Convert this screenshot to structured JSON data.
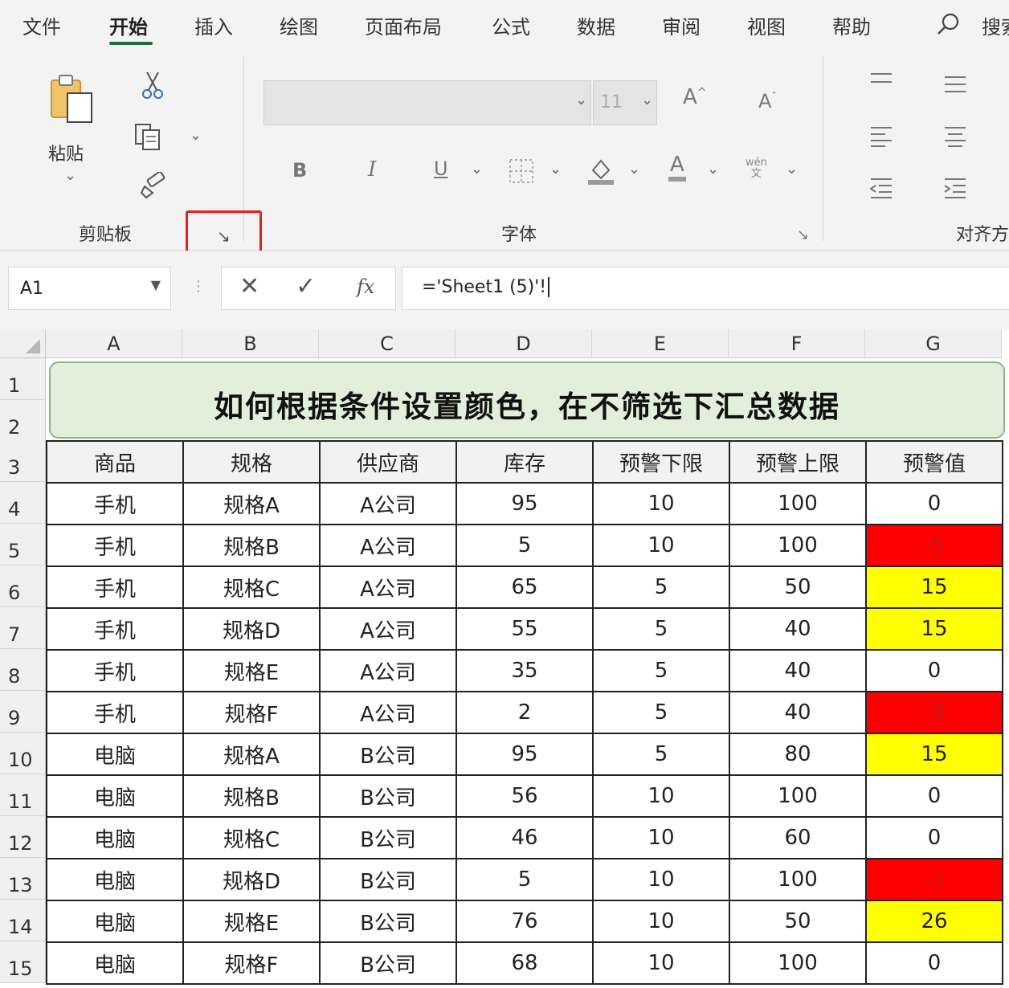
{
  "ribbon_tabs": [
    "文件",
    "开始",
    "插入",
    "绘图",
    "页面布局",
    "公式",
    "数据",
    "审阅",
    "视图",
    "帮助"
  ],
  "search_label": "搜索",
  "clipboard": {
    "paste_label": "粘贴",
    "group_label": "剪贴板"
  },
  "font": {
    "font_name": "",
    "font_size": "11",
    "bold": "B",
    "italic": "I",
    "underline": "U",
    "increase_size": "A",
    "decrease_size": "A",
    "font_color": "A",
    "phonetic": "wén",
    "group_label": "字体"
  },
  "alignment": {
    "group_label": "对齐方式"
  },
  "formula_bar": {
    "name_box": "A1",
    "fx": "fx",
    "formula": "='Sheet1 (5)'!"
  },
  "sheet": {
    "columns": [
      "A",
      "B",
      "C",
      "D",
      "E",
      "F",
      "G"
    ],
    "rows": [
      "1",
      "2",
      "3",
      "4",
      "5",
      "6",
      "7",
      "8",
      "9",
      "10",
      "11",
      "12",
      "13",
      "14",
      "15"
    ],
    "title": "如何根据条件设置颜色，在不筛选下汇总数据",
    "headers": [
      "商品",
      "规格",
      "供应商",
      "库存",
      "预警下限",
      "预警上限",
      "预警值"
    ],
    "data_rows": [
      [
        "手机",
        "规格A",
        "A公司",
        "95",
        "10",
        "100",
        "0"
      ],
      [
        "手机",
        "规格B",
        "A公司",
        "5",
        "10",
        "100",
        "-5"
      ],
      [
        "手机",
        "规格C",
        "A公司",
        "65",
        "5",
        "50",
        "15"
      ],
      [
        "手机",
        "规格D",
        "A公司",
        "55",
        "5",
        "40",
        "15"
      ],
      [
        "手机",
        "规格E",
        "A公司",
        "35",
        "5",
        "40",
        "0"
      ],
      [
        "手机",
        "规格F",
        "A公司",
        "2",
        "5",
        "40",
        "-3"
      ],
      [
        "电脑",
        "规格A",
        "B公司",
        "95",
        "5",
        "80",
        "15"
      ],
      [
        "电脑",
        "规格B",
        "B公司",
        "56",
        "10",
        "100",
        "0"
      ],
      [
        "电脑",
        "规格C",
        "B公司",
        "46",
        "10",
        "60",
        "0"
      ],
      [
        "电脑",
        "规格D",
        "B公司",
        "5",
        "10",
        "100",
        "-5"
      ],
      [
        "电脑",
        "规格E",
        "B公司",
        "76",
        "10",
        "50",
        "26"
      ],
      [
        "电脑",
        "规格F",
        "B公司",
        "68",
        "10",
        "100",
        "0"
      ]
    ],
    "warning_colors": {
      "below_min": "#ff0000",
      "above_max": "#ffff00"
    }
  }
}
